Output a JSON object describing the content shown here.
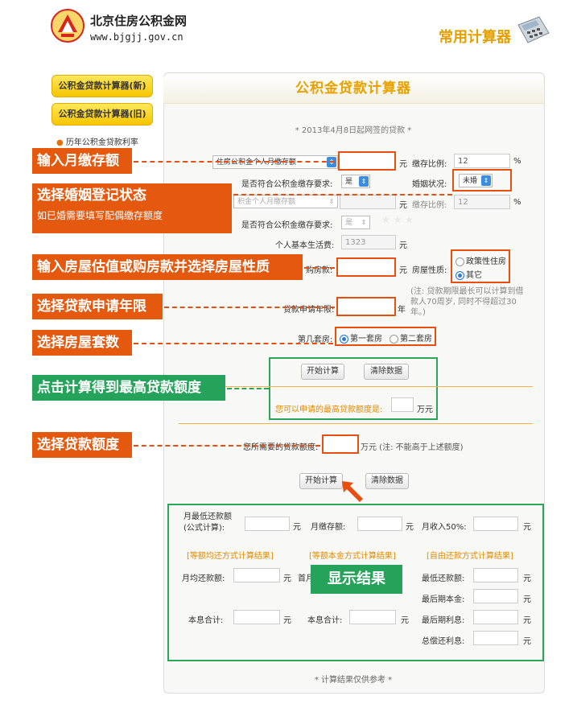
{
  "header": {
    "site_name": "北京住房公积金网",
    "site_url": "www.bjgjj.gov.cn",
    "title": "常用计算器"
  },
  "sidebar": {
    "items": [
      {
        "label": "公积金贷款计算器(新)"
      },
      {
        "label": "公积金贷款计算器(旧)"
      }
    ],
    "link": "历年公积金贷款利率"
  },
  "panel": {
    "title": "公积金贷款计算器",
    "notice": "* 2013年4月8日起网签的贷款 *",
    "footer": "* 计算结果仅供参考 *"
  },
  "form": {
    "deposit_select": "住房公积金个人月缴存额",
    "unit_yuan": "元",
    "ratio_label": "缴存比例:",
    "ratio_value": "12",
    "percent": "%",
    "meets_req_label": "是否符合公积金缴存要求:",
    "yes": "是",
    "marital_label": "婚姻状况:",
    "marital_value": "未婚",
    "spouse_select": "积金个人月缴存额",
    "ratio2_label": "缴存比例:",
    "ratio2_value": "12",
    "meets_req2_label": "是否符合公积金缴存要求:",
    "yes2": "是",
    "min_living_label": "个人基本生活费:",
    "min_living_value": "1323",
    "house_price_label": "购房款:",
    "house_type_label": "房屋性质:",
    "house_type_opt1": "政策性住房",
    "house_type_opt2": "其它",
    "loan_years_label": "贷款申请年限:",
    "unit_year": "年",
    "note": "(注: 贷款期限最长可以计算到借款人70周岁, 同时不得超过30年。)",
    "house_count_label": "第几套房:",
    "first_house": "第一套房",
    "second_house": "第二套房",
    "calc_btn": "开始计算",
    "clear_btn": "清除数据",
    "max_loan_label": "您可以申请的最高贷款额度是:",
    "unit_wan": "万元",
    "need_loan_label": "您所需要的贷款额度:",
    "need_loan_note": "万元 (注: 不能高于上述额度)",
    "calc_btn2": "开始计算",
    "clear_btn2": "清除数据"
  },
  "results": {
    "min_payment_label": "月最低还款额(公式计算):",
    "monthly_deposit_label": "月缴存额:",
    "income_half_label": "月收入50%:",
    "equal_payment_head": "[等额均还方式计算结果]",
    "equal_principal_head": "[等额本金方式计算结果]",
    "free_payment_head": "[自由还款方式计算结果]",
    "monthly_payment_label": "月均还款额:",
    "first_month_label": "首月",
    "min_repay_label": "最低还款额:",
    "last_principal_label": "最后期本金:",
    "total_label": "本息合计:",
    "total2_label": "本息合计:",
    "last_interest_label": "最后期利息:",
    "total_interest_label": "总偿还利息:",
    "unit": "元"
  },
  "callouts": {
    "c1": "输入月缴存额",
    "c2a": "选择婚姻登记状态",
    "c2b": "如已婚需要填写配偶缴存额度",
    "c3": "输入房屋估值或购房款并选择房屋性质",
    "c4": "选择贷款申请年限",
    "c5": "选择房屋套数",
    "c6": "点击计算得到最高贷款额度",
    "c7": "选择贷款额度",
    "show": "显示结果"
  },
  "colors": {
    "orange": "#e5590f",
    "green": "#26a35a",
    "title_gold": "#e9a100"
  }
}
